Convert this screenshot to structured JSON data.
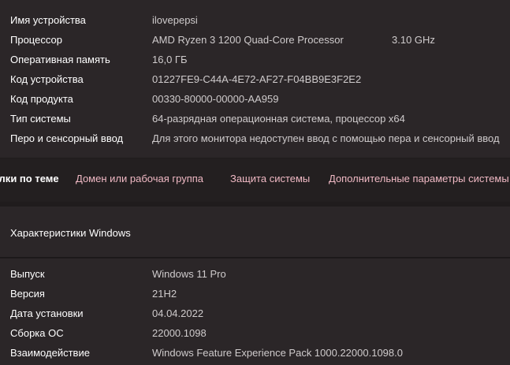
{
  "device_specs": {
    "rows": [
      {
        "label": "Имя устройства",
        "value": "ilovepepsi"
      },
      {
        "label": "Процессор",
        "value": "AMD Ryzen 3 1200 Quad-Core Processor",
        "extra": "3.10 GHz"
      },
      {
        "label": "Оперативная память",
        "value": "16,0 ГБ"
      },
      {
        "label": "Код устройства",
        "value": "01227FE9-C44A-4E72-AF27-F04BB9E3F2E2"
      },
      {
        "label": "Код продукта",
        "value": "00330-80000-00000-AA959"
      },
      {
        "label": "Тип системы",
        "value": "64-разрядная операционная система, процессор x64"
      },
      {
        "label": "Перо и сенсорный ввод",
        "value": "Для этого монитора недоступен ввод с помощью пера и сенсорный ввод"
      }
    ]
  },
  "related_links": {
    "items": [
      {
        "label": "Ссылки по теме"
      },
      {
        "label": "Домен или рабочая группа"
      },
      {
        "label": "Защита системы"
      },
      {
        "label": "Дополнительные параметры системы"
      }
    ]
  },
  "windows_specs": {
    "title": "Характеристики Windows",
    "rows": [
      {
        "label": "Выпуск",
        "value": "Windows 11 Pro"
      },
      {
        "label": "Версия",
        "value": "21H2"
      },
      {
        "label": "Дата установки",
        "value": "04.04.2022"
      },
      {
        "label": "Сборка ОС",
        "value": "22000.1098"
      },
      {
        "label": "Взаимодействие",
        "value": "Windows Feature Experience Pack 1000.22000.1098.0"
      }
    ]
  }
}
